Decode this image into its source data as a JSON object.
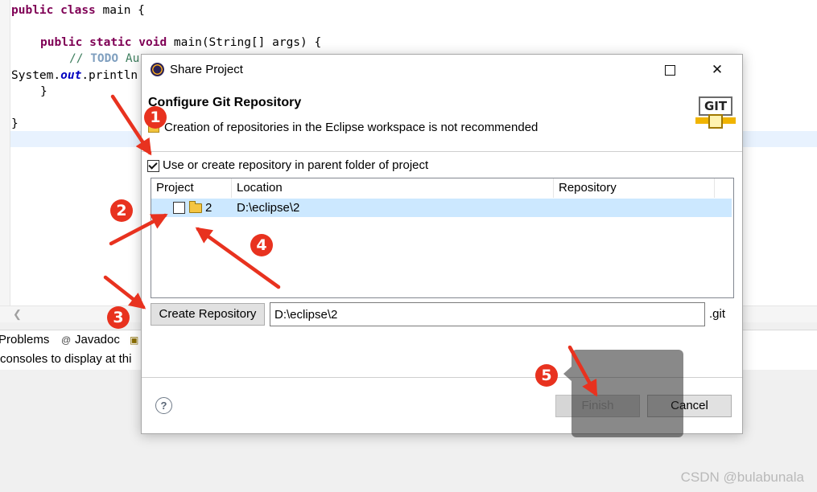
{
  "editor": {
    "lines": [
      "public class main {",
      "public static void main(String[] args) {",
      "// TODO Au",
      "System.out.println",
      "}",
      "}"
    ],
    "views": {
      "tab_problems": "Problems",
      "tab_javadoc": "Javadoc",
      "message": "consoles to display at thi"
    }
  },
  "dialog": {
    "title": "Share Project",
    "header_title": "Configure Git Repository",
    "header_message": "Creation of repositories in the Eclipse workspace is not recommended",
    "git_badge": "GIT",
    "use_parent_label": "Use or create repository in parent folder of project",
    "use_parent_checked": true,
    "table": {
      "columns": [
        "Project",
        "Location",
        "Repository"
      ],
      "rows": [
        {
          "project": "2",
          "location": "D:\\eclipse\\2",
          "repository": "",
          "checked": false
        }
      ]
    },
    "create_repo_label": "Create Repository",
    "repo_path_value": "D:\\eclipse\\2",
    "git_suffix": ".git",
    "finish_label": "Finish",
    "cancel_label": "Cancel",
    "help_icon": "?"
  },
  "annotations": {
    "steps": [
      "1",
      "2",
      "3",
      "4",
      "5"
    ],
    "color": "#e8321f"
  },
  "watermark": "CSDN @bulabunala"
}
